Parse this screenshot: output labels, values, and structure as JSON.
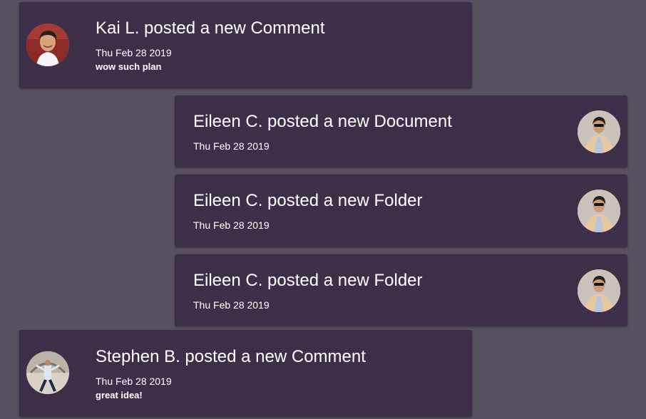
{
  "feed": {
    "items": [
      {
        "author": "Kai L.",
        "title": "Kai L. posted a new Comment",
        "date": "Thu Feb 28 2019",
        "body": "wow such plan",
        "avatar": "kai-avatar"
      },
      {
        "author": "Eileen C.",
        "title": "Eileen C. posted a new Document",
        "date": "Thu Feb 28 2019",
        "avatar": "eileen-avatar"
      },
      {
        "author": "Eileen C.",
        "title": "Eileen C. posted a new Folder",
        "date": "Thu Feb 28 2019",
        "avatar": "eileen-avatar"
      },
      {
        "author": "Eileen C.",
        "title": "Eileen C. posted a new Folder",
        "date": "Thu Feb 28 2019",
        "avatar": "eileen-avatar"
      },
      {
        "author": "Stephen B.",
        "title": "Stephen B. posted a new Comment",
        "date": "Thu Feb 28 2019",
        "body": "great idea!",
        "avatar": "stephen-avatar"
      }
    ]
  },
  "colors": {
    "background": "#585260",
    "card": "#3d2f47",
    "text": "#ffffff"
  }
}
